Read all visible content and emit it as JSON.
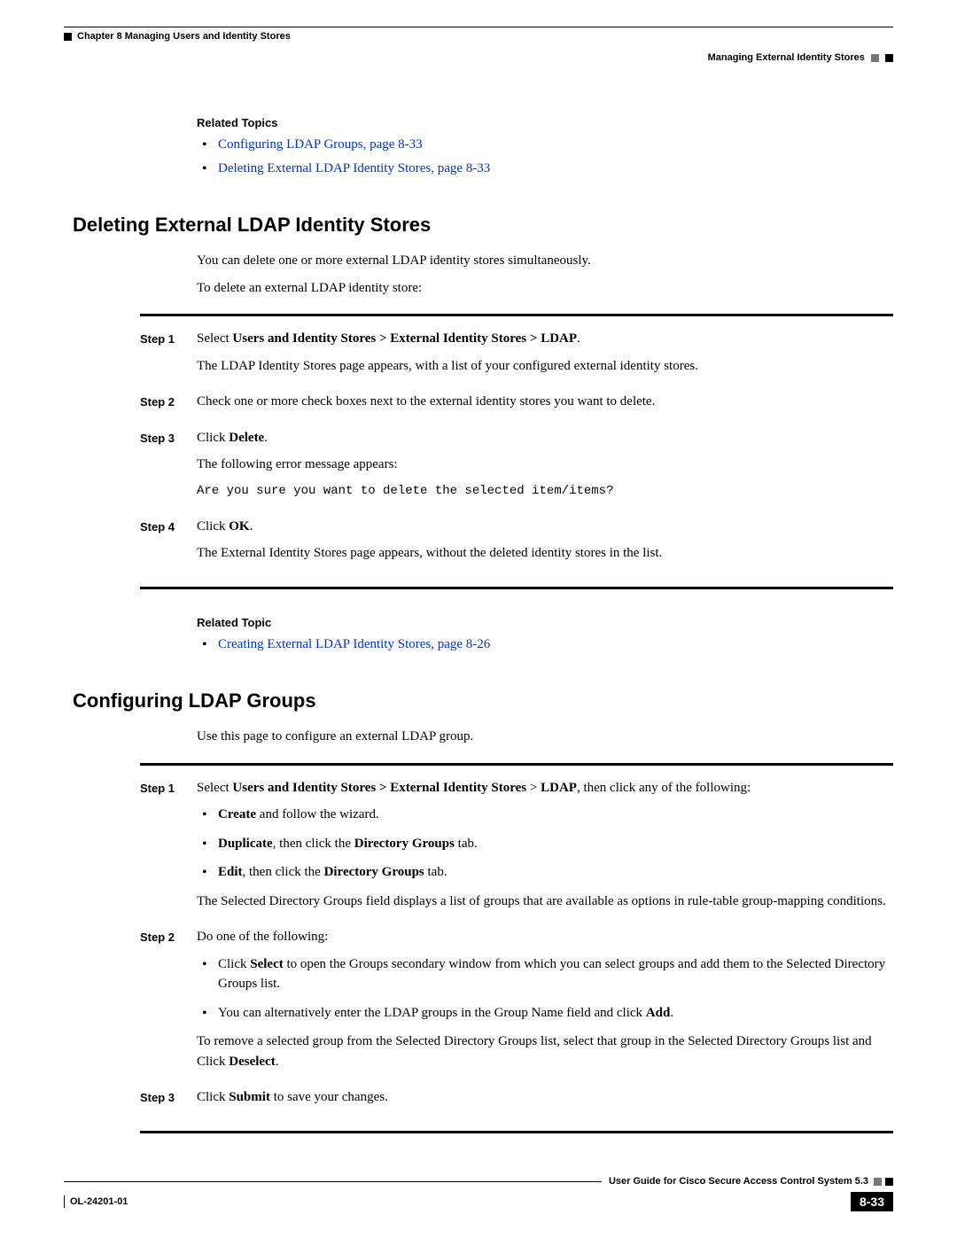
{
  "header": {
    "chapter": "Chapter 8      Managing Users and Identity Stores",
    "section": "Managing External Identity Stores"
  },
  "related1": {
    "title": "Related Topics",
    "items": [
      "Configuring LDAP Groups, page 8-33",
      "Deleting External LDAP Identity Stores, page 8-33"
    ]
  },
  "sec1": {
    "title": "Deleting External LDAP Identity Stores",
    "p1": "You can delete one or more external LDAP identity stores simultaneously.",
    "p2": "To delete an external LDAP identity store:",
    "steps": [
      {
        "label": "Step 1",
        "lines": [
          {
            "t": "mixed",
            "pre": "Select ",
            "bold": "Users and Identity Stores > External Identity Stores > LDAP",
            "post": "."
          },
          {
            "t": "plain",
            "text": "The LDAP Identity Stores page appears, with a list of your configured external identity stores."
          }
        ]
      },
      {
        "label": "Step 2",
        "lines": [
          {
            "t": "plain",
            "text": "Check one or more check boxes next to the external identity stores you want to delete."
          }
        ]
      },
      {
        "label": "Step 3",
        "lines": [
          {
            "t": "mixed",
            "pre": "Click ",
            "bold": "Delete",
            "post": "."
          },
          {
            "t": "plain",
            "text": "The following error message appears:"
          },
          {
            "t": "mono",
            "text": "Are you sure you want to delete the selected item/items?"
          }
        ]
      },
      {
        "label": "Step 4",
        "lines": [
          {
            "t": "mixed",
            "pre": "Click ",
            "bold": "OK",
            "post": "."
          },
          {
            "t": "plain",
            "text": "The External Identity Stores page appears, without the deleted identity stores in the list."
          }
        ]
      }
    ]
  },
  "related2": {
    "title": "Related Topic",
    "items": [
      "Creating External LDAP Identity Stores, page 8-26"
    ]
  },
  "sec2": {
    "title": "Configuring LDAP Groups",
    "p1": "Use this page to configure an external LDAP group.",
    "steps": {
      "s1": {
        "label": "Step 1",
        "intro_pre": "Select ",
        "intro_bold1": "Users and Identity Stores > External Identity Stores",
        "intro_mid": " > ",
        "intro_bold2": "LDAP",
        "intro_post": ", then click any of the following:",
        "bullets": [
          {
            "b": "Create",
            "rest": " and follow the wizard."
          },
          {
            "b": "Duplicate",
            "mid": ", then click the ",
            "b2": "Directory Groups",
            "rest": " tab."
          },
          {
            "b": "Edit",
            "mid": ", then click the ",
            "b2": "Directory Groups",
            "rest": " tab."
          }
        ],
        "after": "The Selected Directory Groups field displays a list of groups that are available as options in rule-table group-mapping conditions."
      },
      "s2": {
        "label": "Step 2",
        "intro": "Do one of the following:",
        "b1_pre": "Click ",
        "b1_bold": "Select",
        "b1_rest": " to open the Groups secondary window from which you can select groups and add them to the Selected Directory Groups list.",
        "b2_pre": "You can alternatively enter the LDAP groups in the Group Name field and click ",
        "b2_bold": "Add",
        "b2_post": ".",
        "after_pre": "To remove a selected group from the Selected Directory Groups list, select that group in the Selected Directory Groups list and Click ",
        "after_bold": "Deselect",
        "after_post": "."
      },
      "s3": {
        "label": "Step 3",
        "pre": "Click ",
        "bold": "Submit",
        "post": " to save your changes."
      }
    }
  },
  "footer": {
    "guide": "User Guide for Cisco Secure Access Control System 5.3",
    "doc": "OL-24201-01",
    "page": "8-33"
  }
}
